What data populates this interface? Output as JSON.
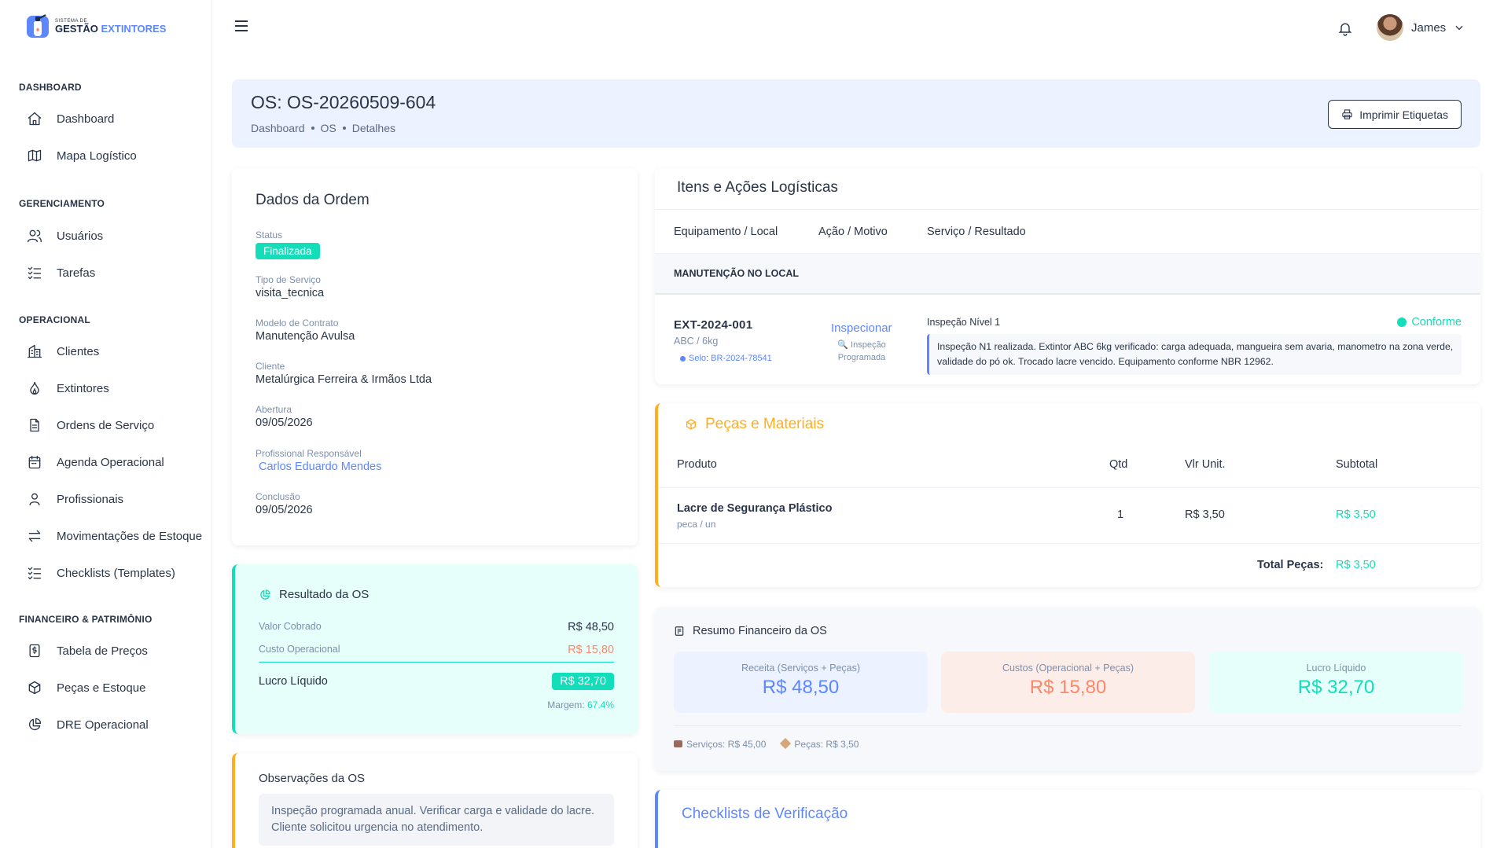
{
  "brand": {
    "small": "SISTEMA DE",
    "big_a": "GESTÃO",
    "big_b": "EXTINTORES"
  },
  "sidebar": {
    "sections": [
      {
        "title": "DASHBOARD",
        "items": [
          {
            "label": "Dashboard",
            "icon": "home-icon"
          },
          {
            "label": "Mapa Logístico",
            "icon": "map-icon"
          }
        ]
      },
      {
        "title": "GERENCIAMENTO",
        "items": [
          {
            "label": "Usuários",
            "icon": "users-icon"
          },
          {
            "label": "Tarefas",
            "icon": "list-check-icon"
          }
        ]
      },
      {
        "title": "OPERACIONAL",
        "items": [
          {
            "label": "Clientes",
            "icon": "building-icon"
          },
          {
            "label": "Extintores",
            "icon": "flame-icon"
          },
          {
            "label": "Ordens de Serviço",
            "icon": "file-icon"
          },
          {
            "label": "Agenda Operacional",
            "icon": "calendar-icon"
          },
          {
            "label": "Profissionais",
            "icon": "user-icon"
          },
          {
            "label": "Movimentações de Estoque",
            "icon": "arrows-icon"
          },
          {
            "label": "Checklists (Templates)",
            "icon": "list-check-icon"
          }
        ]
      },
      {
        "title": "FINANCEIRO & PATRIMÔNIO",
        "items": [
          {
            "label": "Tabela de Preços",
            "icon": "dollar-icon"
          },
          {
            "label": "Peças e Estoque",
            "icon": "box-icon"
          },
          {
            "label": "DRE Operacional",
            "icon": "pie-icon"
          }
        ]
      }
    ]
  },
  "header": {
    "user_name": "James"
  },
  "page": {
    "title": "OS: OS-20260509-604",
    "breadcrumbs": [
      "Dashboard",
      "OS",
      "Detalhes"
    ],
    "print_button": "Imprimir Etiquetas"
  },
  "dados": {
    "title": "Dados da Ordem",
    "status_label": "Status",
    "status": "Finalizada",
    "tipo_label": "Tipo de Serviço",
    "tipo": "visita_tecnica",
    "modelo_label": "Modelo de Contrato",
    "modelo": "Manutenção Avulsa",
    "cliente_label": "Cliente",
    "cliente": "Metalúrgica Ferreira & Irmãos Ltda",
    "abertura_label": "Abertura",
    "abertura": "09/05/2026",
    "profissional_label": "Profissional Responsável",
    "profissional": "Carlos Eduardo Mendes",
    "conclusao_label": "Conclusão",
    "conclusao": "09/05/2026"
  },
  "resultado": {
    "title": "Resultado da OS",
    "valor_label": "Valor Cobrado",
    "valor": "R$ 48,50",
    "custo_label": "Custo Operacional",
    "custo": "R$ 15,80",
    "lucro_label": "Lucro Líquido",
    "lucro": "R$ 32,70",
    "margem_label": "Margem:",
    "margem": "67.4%"
  },
  "observacoes": {
    "title": "Observações da OS",
    "text": "Inspeção programada anual. Verificar carga e validade do lacre. Cliente solicitou urgencia no atendimento."
  },
  "itens": {
    "title": "Itens e Ações Logísticas",
    "columns": [
      "Equipamento / Local",
      "Ação / Motivo",
      "Serviço / Resultado"
    ],
    "group": "MANUTENÇÃO NO LOCAL",
    "row": {
      "code": "EXT-2024-001",
      "spec": "ABC / 6kg",
      "selo": "Selo: BR-2024-78541",
      "acao": "Inspecionar",
      "motivo": "Inspeção Programada",
      "servico": "Inspeção Nível 1",
      "resultado": "Conforme",
      "nota": "Inspeção N1 realizada. Extintor ABC 6kg verificado: carga adequada, mangueira sem avaria, manometro na zona verde, validade do pó ok. Trocado lacre vencido. Equipamento conforme NBR 12962."
    }
  },
  "pecas": {
    "title": "Peças e Materiais",
    "columns": [
      "Produto",
      "Qtd",
      "Vlr Unit.",
      "Subtotal"
    ],
    "row": {
      "produto": "Lacre de Segurança Plástico",
      "unidade": "peca / un",
      "qtd": "1",
      "unit": "R$ 3,50",
      "subtotal": "R$ 3,50"
    },
    "total_label": "Total Peças:",
    "total": "R$ 3,50"
  },
  "resumo": {
    "title": "Resumo Financeiro da OS",
    "receita_label": "Receita (Serviços + Peças)",
    "receita": "R$ 48,50",
    "custos_label": "Custos (Operacional + Peças)",
    "custos": "R$ 15,80",
    "lucro_label": "Lucro Líquido",
    "lucro": "R$ 32,70",
    "servicos": "Serviços: R$ 45,00",
    "pecas": "Peças: R$ 3,50"
  },
  "checklists": {
    "title": "Checklists de Verificação"
  },
  "colors": {
    "primary": "#5d87ff",
    "success": "#13deb9",
    "warning": "#ffae1f",
    "danger": "#fa896b",
    "text": "#2a3547"
  }
}
